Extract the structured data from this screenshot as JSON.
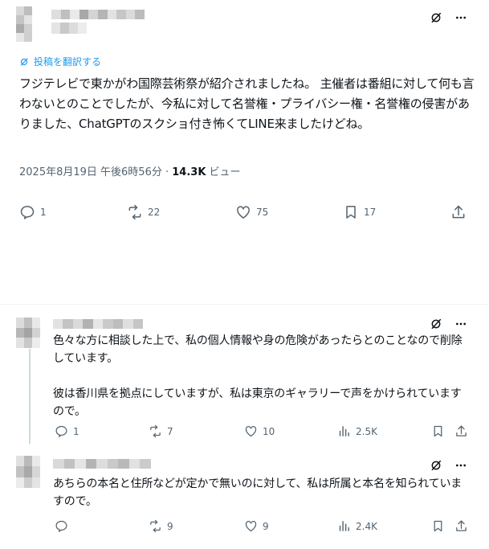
{
  "main_post": {
    "translate_label": "投稿を翻訳する",
    "text": "フジテレビで東かがわ国際芸術祭が紹介されましたね。 主催者は番組に対して何も言わないとのことでしたが、今私に対して名誉権・プライバシー権・名誉権の侵害がありました、ChatGPTのスクショ付き怖くてLINE来ましたけどね。",
    "timestamp": "2025年8月19日 午後6時56分",
    "separator": " · ",
    "views_count": "14.3K",
    "views_label": " ビュー",
    "actions": {
      "replies": "1",
      "reposts": "22",
      "likes": "75",
      "bookmarks": "17"
    }
  },
  "replies": [
    {
      "text": "色々な方に相談した上で、私の個人情報や身の危険があったらとのことなので削除しています。\n\n彼は香川県を拠点にしていますが、私は東京のギャラリーで声をかけられていますので。",
      "actions": {
        "replies": "1",
        "reposts": "7",
        "likes": "10",
        "views": "2.5K"
      }
    },
    {
      "text": "あちらの本名と住所などが定かで無いのに対して、私は所属と本名を知られていますので。",
      "actions": {
        "replies": "",
        "reposts": "9",
        "likes": "9",
        "views": "2.4K"
      }
    }
  ],
  "icons": {
    "grok": "grok-icon",
    "more": "more-icon",
    "translate": "translate-icon",
    "reply": "reply-icon",
    "repost": "repost-icon",
    "like": "like-icon",
    "views": "views-icon",
    "bookmark": "bookmark-icon",
    "share": "share-icon"
  },
  "colors": {
    "text": "#0f1419",
    "muted": "#536471",
    "link": "#1d9bf0",
    "divider": "#eff3f4",
    "thread_line": "#cfd9de",
    "censor_light": "#e6e6e6",
    "censor_mid": "#c7c7c7",
    "censor_dark": "#9e9e9e"
  }
}
